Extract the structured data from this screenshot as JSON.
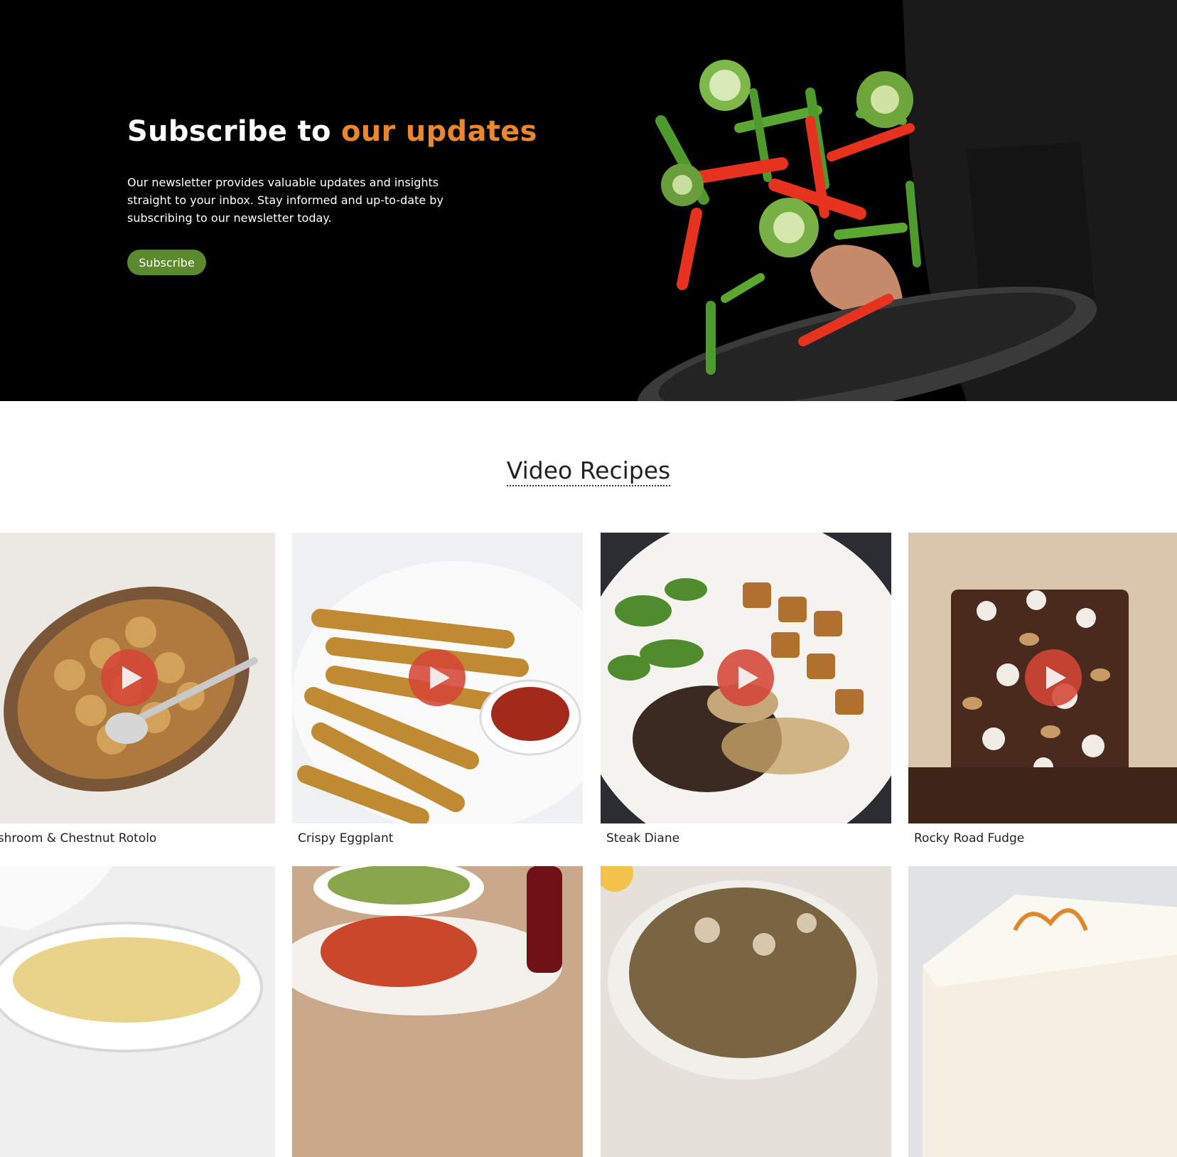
{
  "hero": {
    "title_plain": "Subscribe to ",
    "title_accent": "our updates",
    "description": "Our newsletter provides valuable updates and insights straight to your inbox. Stay informed and up-to-date by subscribing to our newsletter today.",
    "subscribe_label": "Subscribe",
    "accent_color": "#e8872d",
    "button_color": "#5b8a2e"
  },
  "video_section": {
    "title": "Video Recipes",
    "play_color": "#d44636",
    "row1": [
      {
        "title": "ushroom & Chestnut Rotolo"
      },
      {
        "title": "Crispy Eggplant"
      },
      {
        "title": "Steak Diane"
      },
      {
        "title": "Rocky Road Fudge"
      }
    ]
  }
}
